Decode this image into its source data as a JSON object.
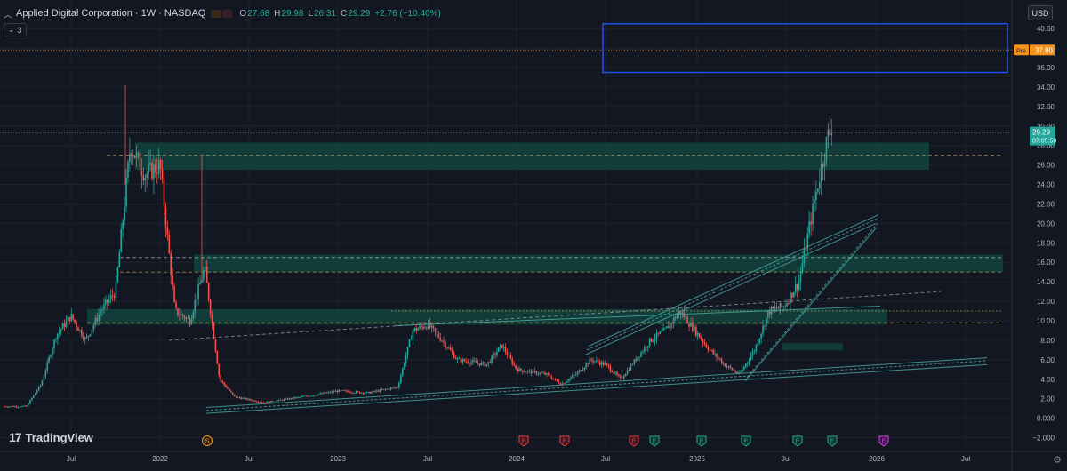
{
  "header": {
    "title": "Applied Digital Corporation · 1W · NASDAQ",
    "ohlc": [
      {
        "key": "O",
        "value": "27.68"
      },
      {
        "key": "H",
        "value": "29.98"
      },
      {
        "key": "L",
        "value": "26.31"
      },
      {
        "key": "C",
        "value": "29.29"
      }
    ],
    "change": "+2.76 (+10.40%)",
    "indicator_count": "3"
  },
  "currency": "USD",
  "brand": "TradingView",
  "colors": {
    "background": "#131722",
    "up": "#26a69a",
    "down": "#ef5350",
    "zone": "#134640",
    "projection_box": "#1e53e5",
    "pre_label": "#f7931a",
    "price_label": "#26a69a"
  },
  "chart_data": {
    "type": "candlestick",
    "ylim": [
      -2.0,
      41.0
    ],
    "yticks": [
      -2.0,
      0.0,
      2.0,
      4.0,
      6.0,
      8.0,
      10.0,
      12.0,
      14.0,
      16.0,
      18.0,
      20.0,
      22.0,
      24.0,
      26.0,
      28.0,
      30.0,
      32.0,
      34.0,
      36.0,
      38.0,
      40.0
    ],
    "ytick_labels": [
      "−2.000",
      "0.000",
      "2.00",
      "4.00",
      "6.00",
      "8.00",
      "10.00",
      "12.00",
      "14.00",
      "16.00",
      "18.00",
      "20.00",
      "22.00",
      "24.00",
      "26.00",
      "28.00",
      "30.00",
      "32.00",
      "34.00",
      "36.00",
      "38.00",
      "40.00"
    ],
    "x_labels": [
      "Jul",
      "2022",
      "Jul",
      "2023",
      "Jul",
      "2024",
      "Jul",
      "2025",
      "Jul",
      "2026",
      "Jul"
    ],
    "last_price": {
      "value": 29.29,
      "label": "29.29",
      "countdown": "07:05:59"
    },
    "pre_market": {
      "label": "Pre",
      "value": 37.8,
      "text": "37.80"
    },
    "trend": [
      {
        "date": "2021-04",
        "price": 1.2
      },
      {
        "date": "2021-05",
        "price": 3.5
      },
      {
        "date": "2021-06",
        "price": 8.5
      },
      {
        "date": "2021-07",
        "price": 10.5
      },
      {
        "date": "2021-08",
        "price": 8.0
      },
      {
        "date": "2021-09",
        "price": 11.0
      },
      {
        "date": "2021-10",
        "price": 13.0
      },
      {
        "date": "2021-11",
        "price": 28.0
      },
      {
        "date": "2021-12",
        "price": 25.0
      },
      {
        "date": "2022-01",
        "price": 26.0
      },
      {
        "date": "2022-02",
        "price": 11.0
      },
      {
        "date": "2022-03",
        "price": 10.0
      },
      {
        "date": "2022-04",
        "price": 15.5
      },
      {
        "date": "2022-05",
        "price": 4.0
      },
      {
        "date": "2022-06",
        "price": 2.2
      },
      {
        "date": "2022-08",
        "price": 1.6
      },
      {
        "date": "2022-11",
        "price": 2.3
      },
      {
        "date": "2023-01",
        "price": 2.8
      },
      {
        "date": "2023-03",
        "price": 2.6
      },
      {
        "date": "2023-05",
        "price": 3.2
      },
      {
        "date": "2023-06",
        "price": 9.0
      },
      {
        "date": "2023-07",
        "price": 9.6
      },
      {
        "date": "2023-08",
        "price": 8.0
      },
      {
        "date": "2023-09",
        "price": 6.0
      },
      {
        "date": "2023-11",
        "price": 5.5
      },
      {
        "date": "2023-12",
        "price": 7.5
      },
      {
        "date": "2024-01",
        "price": 5.0
      },
      {
        "date": "2024-03",
        "price": 4.5
      },
      {
        "date": "2024-04",
        "price": 3.5
      },
      {
        "date": "2024-05",
        "price": 4.5
      },
      {
        "date": "2024-06",
        "price": 6.0
      },
      {
        "date": "2024-07",
        "price": 5.5
      },
      {
        "date": "2024-08",
        "price": 4.0
      },
      {
        "date": "2024-10",
        "price": 8.0
      },
      {
        "date": "2024-11",
        "price": 9.0
      },
      {
        "date": "2024-12",
        "price": 11.0
      },
      {
        "date": "2025-01",
        "price": 9.0
      },
      {
        "date": "2025-02",
        "price": 7.0
      },
      {
        "date": "2025-03",
        "price": 5.5
      },
      {
        "date": "2025-04",
        "price": 4.5
      },
      {
        "date": "2025-05",
        "price": 7.0
      },
      {
        "date": "2025-06",
        "price": 11.0
      },
      {
        "date": "2025-07",
        "price": 11.5
      },
      {
        "date": "2025-08",
        "price": 14.0
      },
      {
        "date": "2025-09",
        "price": 22.0
      },
      {
        "date": "2025-10",
        "price": 29.29
      }
    ],
    "zones": [
      {
        "from": 25.5,
        "to": 28.3
      },
      {
        "from": 15.0,
        "to": 16.8
      },
      {
        "from": 9.6,
        "to": 11.2
      }
    ],
    "dotted_lines": [
      27.0,
      16.5,
      15.0,
      9.8,
      29.3,
      37.8
    ],
    "projection_box": {
      "low": 35.5,
      "high": 40.5
    },
    "event_markers": [
      {
        "letter": "S",
        "kind": "split"
      },
      {
        "letter": "E",
        "kind": "earnings-past"
      },
      {
        "letter": "E",
        "kind": "earnings-past"
      },
      {
        "letter": "E",
        "kind": "earnings-past"
      },
      {
        "letter": "E",
        "kind": "earnings-beat"
      },
      {
        "letter": "E",
        "kind": "earnings-beat"
      },
      {
        "letter": "E",
        "kind": "earnings-beat"
      },
      {
        "letter": "E",
        "kind": "earnings-beat"
      },
      {
        "letter": "E",
        "kind": "earnings-beat"
      },
      {
        "letter": "E",
        "kind": "earnings-upcoming"
      }
    ]
  }
}
